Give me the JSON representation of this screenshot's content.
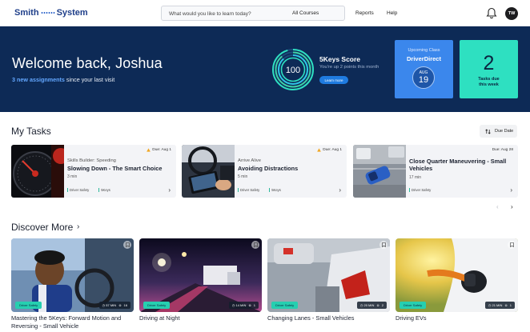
{
  "nav": {
    "logo_left": "Smith",
    "logo_right": "System",
    "search_placeholder": "What would you like to learn today?",
    "course_filter": "All Courses",
    "links": [
      "Reports",
      "Help"
    ],
    "user_initials": "TW"
  },
  "hero": {
    "greeting": "Welcome back, Joshua",
    "assignments_count": "3 new assignments",
    "assignments_suffix": " since your last visit",
    "score": {
      "value": "100",
      "title": "5Keys Score",
      "subtitle": "You're up 2 points this month",
      "button": "Learn more"
    },
    "upcoming_class": {
      "label": "Upcoming Class",
      "name": "DriverDirect",
      "month": "AUG",
      "day": "19"
    },
    "tasks_due": {
      "count": "2",
      "line1": "Tasks due",
      "line2": "this week"
    },
    "colors": {
      "background": "#0d2a56",
      "class_card": "#3b87ec",
      "tasks_card": "#2ee0c1"
    }
  },
  "my_tasks": {
    "title": "My Tasks",
    "sort_label": "Due Date",
    "items": [
      {
        "category": "Skills Builder: Speeding",
        "title": "Slowing Down - The Smart Choice",
        "duration": "3 min",
        "due": "Due: Aug 1",
        "tags": [
          "Driver Safety",
          "5Keys"
        ],
        "warning": true
      },
      {
        "category": "Arrive Alive",
        "title": "Avoiding Distractions",
        "duration": "5 min",
        "due": "Due: Aug 1",
        "tags": [
          "Driver Safety",
          "5Keys"
        ],
        "warning": true
      },
      {
        "category": "",
        "title": "Close Quarter Maneuvering - Small Vehicles",
        "duration": "17 min",
        "due": "Due: Aug 28",
        "tags": [
          "Driver Safety"
        ],
        "warning": false
      }
    ]
  },
  "discover": {
    "title": "Discover More",
    "cards": [
      {
        "title_line1": "Mastering the 5Keys: Forward Motion and",
        "title_line2": "Reversing - Small Vehicle",
        "tag": "Driver Safety",
        "duration": "57 MIN",
        "count": "16"
      },
      {
        "title_line1": "Driving at Night",
        "title_line2": "",
        "tag": "Driver Safety",
        "duration": "14 MIN",
        "count": "1"
      },
      {
        "title_line1": "Changing Lanes - Small Vehicles",
        "title_line2": "",
        "tag": "Driver Safety",
        "duration": "20 MIN",
        "count": "2"
      },
      {
        "title_line1": "Driving EVs",
        "title_line2": "",
        "tag": "Driver Safety",
        "duration": "21 MIN",
        "count": "1"
      }
    ]
  }
}
